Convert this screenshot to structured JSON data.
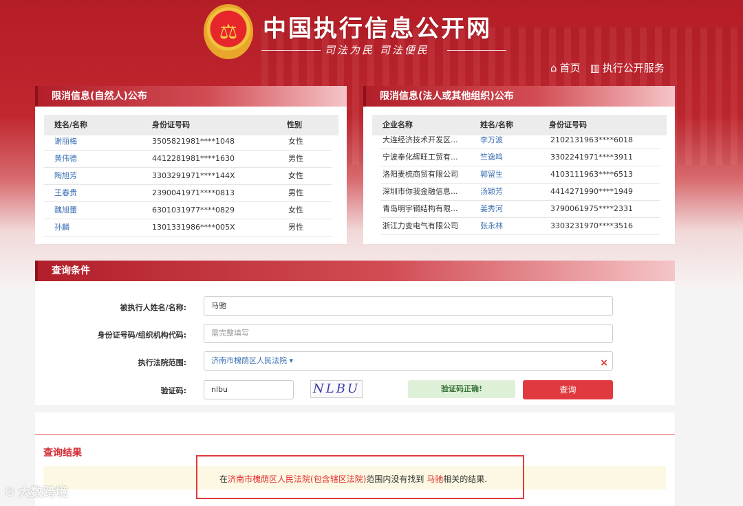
{
  "header": {
    "site_title": "中国执行信息公开网",
    "slogan": "司法为民  司法便民",
    "nav": [
      {
        "label": "首页",
        "icon": "home-icon"
      },
      {
        "label": "执行公开服务",
        "icon": "bar-chart-icon"
      }
    ]
  },
  "persons_panel": {
    "title": "限消信息(自然人)公布",
    "columns": [
      "姓名/名称",
      "身份证号码",
      "性别"
    ],
    "rows": [
      {
        "name": "谢丽梅",
        "id": "3505821981****1048",
        "gender": "女性"
      },
      {
        "name": "黄伟德",
        "id": "4412281981****1630",
        "gender": "男性"
      },
      {
        "name": "陶旭芳",
        "id": "3303291971****144X",
        "gender": "女性"
      },
      {
        "name": "王春贵",
        "id": "2390041971****0813",
        "gender": "男性"
      },
      {
        "name": "魏旭蕾",
        "id": "6301031977****0829",
        "gender": "女性"
      },
      {
        "name": "孙麟",
        "id": "1301331986****005X",
        "gender": "男性"
      }
    ]
  },
  "orgs_panel": {
    "title": "限消信息(法人或其他组织)公布",
    "columns": [
      "企业名称",
      "姓名/名称",
      "身份证号码"
    ],
    "rows": [
      {
        "company": "大连经济技术开发区...",
        "name": "李万波",
        "id": "2102131963****6018"
      },
      {
        "company": "宁波奉化辉旺工贸有...",
        "name": "竺逸鸣",
        "id": "3302241971****3911"
      },
      {
        "company": "洛阳麦梳商贸有限公司",
        "name": "郭留生",
        "id": "4103111963****6513"
      },
      {
        "company": "深圳市你我金融信息...",
        "name": "汤颖芳",
        "id": "4414271990****1949"
      },
      {
        "company": "青岛明宇钢结构有限...",
        "name": "姜秀河",
        "id": "3790061975****2331"
      },
      {
        "company": "浙江力变电气有限公司",
        "name": "张永林",
        "id": "3303231970****3516"
      }
    ]
  },
  "query": {
    "title": "查询条件",
    "name_label": "被执行人姓名/名称:",
    "name_value": "马驰",
    "id_label": "身份证号码/组织机构代码:",
    "id_placeholder": "需完整填写",
    "court_label": "执行法院范围:",
    "court_value": "济南市槐荫区人民法院",
    "captcha_label": "验证码:",
    "captcha_value": "nlbu",
    "captcha_image_text": "NLBU",
    "captcha_status": "验证码正确!",
    "search_button": "查询"
  },
  "result": {
    "title": "查询结果",
    "text_prefix": "在",
    "court": "济南市槐荫区人民法院(包含辖区法院)",
    "text_mid": "范围内没有找到 ",
    "name": "马驰",
    "text_suffix": "相关的结果."
  },
  "watermark": "大数跨境"
}
